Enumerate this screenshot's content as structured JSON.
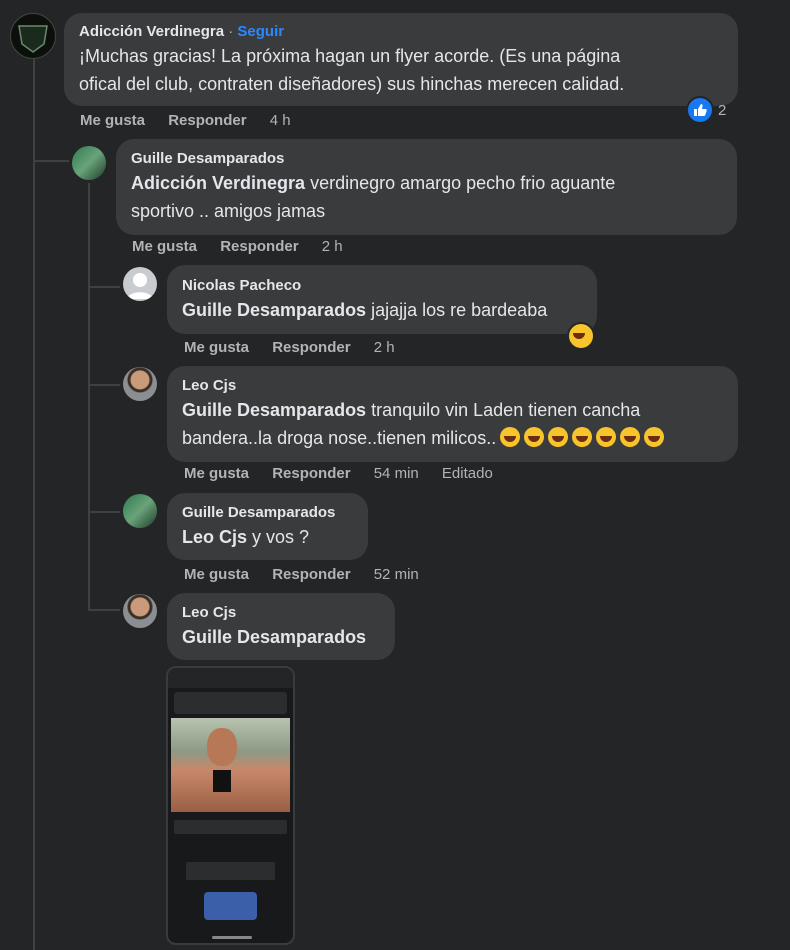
{
  "comments": {
    "c1": {
      "author": "Adicción Verdinegra",
      "separator": "·",
      "follow": "Seguir",
      "line1": "¡Muchas gracias! La próxima hagan un flyer acorde. (Es una página",
      "line2": "ofical del club, contraten diseñadores) sus hinchas merecen calidad.",
      "like": "Me gusta",
      "reply": "Responder",
      "time": "4 h",
      "reaction_count": "2"
    },
    "c2": {
      "author": "Guille Desamparados",
      "mention": "Adicción Verdinegra",
      "line1": "verdinegro amargo pecho frio aguante",
      "line2": "sportivo .. amigos jamas",
      "like": "Me gusta",
      "reply": "Responder",
      "time": "2 h"
    },
    "c3": {
      "author": "Nicolas Pacheco",
      "mention": "Guille Desamparados",
      "text": "jajajja los re bardeaba",
      "like": "Me gusta",
      "reply": "Responder",
      "time": "2 h"
    },
    "c4": {
      "author": "Leo Cjs",
      "mention": "Guille Desamparados",
      "line1": "tranquilo vin Laden tienen cancha",
      "line2": "bandera..la droga nose..tienen milicos..",
      "like": "Me gusta",
      "reply": "Responder",
      "time": "54 min",
      "edited": "Editado"
    },
    "c5": {
      "author": "Guille Desamparados",
      "mention": "Leo Cjs",
      "text": "y vos ?",
      "like": "Me gusta",
      "reply": "Responder",
      "time": "52 min"
    },
    "c6": {
      "author": "Leo Cjs",
      "mention": "Guille Desamparados"
    }
  },
  "icons": {
    "reaction": "like-thumb-icon",
    "emoji": "laughing-emoji-icon",
    "avatar_logo": "adv-logo-icon"
  },
  "colors": {
    "background": "#242526",
    "bubble": "#3a3b3c",
    "link": "#2d88ff",
    "secondary_text": "#b0b3b8"
  }
}
